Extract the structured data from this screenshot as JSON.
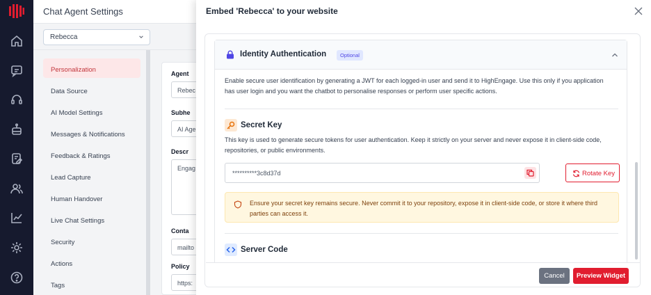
{
  "colors": {
    "rail": "#161a2e",
    "accent": "#e11d2f",
    "cancel": "#6b7280",
    "badge_text": "#4f46e5",
    "warning_bg": "#fff7e0"
  },
  "rail": {
    "icons": [
      "home-icon",
      "chat-icon",
      "headset-icon",
      "bot-icon",
      "edit-document-icon",
      "users-icon",
      "analytics-icon",
      "settings-icon",
      "help-icon"
    ]
  },
  "page": {
    "title": "Chat Agent Settings",
    "agent_select": "Rebecca",
    "menu": [
      "Personalization",
      "Data Source",
      "AI Model Settings",
      "Messages & Notifications",
      "Feedback & Ratings",
      "Lead Capture",
      "Human Handover",
      "Live Chat Settings",
      "Security",
      "Actions",
      "Tags"
    ],
    "fields": [
      {
        "label": "Agent",
        "value": "Rebec"
      },
      {
        "label": "Subhe",
        "value": "AI Age"
      },
      {
        "label": "Descr",
        "value": "Engag"
      },
      {
        "label": "Conta",
        "value": "mailto"
      },
      {
        "label": "Policy",
        "value": "https:"
      }
    ]
  },
  "modal": {
    "title": "Embed 'Rebecca' to your website",
    "section_title": "Identity Authentication",
    "badge": "Optional",
    "section_description": "Enable secure user identification by generating a JWT for each logged-in user and send it to HighEngage. Use this only if you application has user login and you want the chatbot to personalise responses or perform user specific actions.",
    "secret_key": {
      "title": "Secret Key",
      "description": "This key is used to generate secure tokens for user authentication. Keep it strictly on your server and never expose it in client-side code, repositories, or public environments.",
      "value": "**********3c8d37d",
      "rotate_label": "Rotate Key"
    },
    "warning": "Ensure your secret key remains secure. Never commit it to your repository, expose it in client-side code, or store it where third parties can access it.",
    "server_code_title": "Server Code",
    "cancel_label": "Cancel",
    "preview_label": "Preview Widget"
  }
}
